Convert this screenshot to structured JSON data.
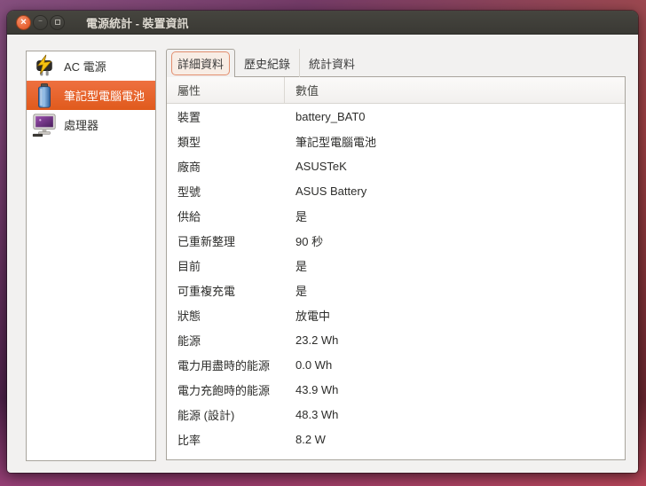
{
  "window": {
    "title": "電源統計 - 裝置資訊"
  },
  "titlebar": {
    "close_glyph": "✕",
    "minimize_glyph": "—",
    "buttons": [
      "close-button",
      "minimize-button",
      "maximize-button"
    ]
  },
  "sidebar": {
    "items": [
      {
        "label": "AC 電源",
        "icon": "ac-power-icon",
        "selected": false
      },
      {
        "label": "筆記型電腦電池",
        "icon": "laptop-battery-icon",
        "selected": true
      },
      {
        "label": "處理器",
        "icon": "processor-icon",
        "selected": false
      }
    ]
  },
  "tabs": [
    {
      "label": "詳細資料",
      "active": true
    },
    {
      "label": "歷史紀錄",
      "active": false
    },
    {
      "label": "統計資料",
      "active": false
    }
  ],
  "table": {
    "headers": [
      "屬性",
      "數值"
    ],
    "rows": [
      [
        "裝置",
        "battery_BAT0"
      ],
      [
        "類型",
        "筆記型電腦電池"
      ],
      [
        "廠商",
        "ASUSTeK"
      ],
      [
        "型號",
        "ASUS Battery"
      ],
      [
        "供給",
        "是"
      ],
      [
        "已重新整理",
        "90 秒"
      ],
      [
        "目前",
        "是"
      ],
      [
        "可重複充電",
        "是"
      ],
      [
        "狀態",
        "放電中"
      ],
      [
        "能源",
        "23.2 Wh"
      ],
      [
        "電力用盡時的能源",
        "0.0 Wh"
      ],
      [
        "電力充飽時的能源",
        "43.9 Wh"
      ],
      [
        "能源 (設計)",
        "48.3 Wh"
      ],
      [
        "比率",
        "8.2 W"
      ]
    ]
  },
  "colors": {
    "accent_orange": "#E95420",
    "selection_gradient_top": "#EE7040",
    "selection_gradient_bottom": "#E05A1C",
    "titlebar": "#3C3B36",
    "window_bg": "#F2F1F0",
    "desktop_purple": "#7E4476",
    "desktop_red": "#A8433A"
  }
}
